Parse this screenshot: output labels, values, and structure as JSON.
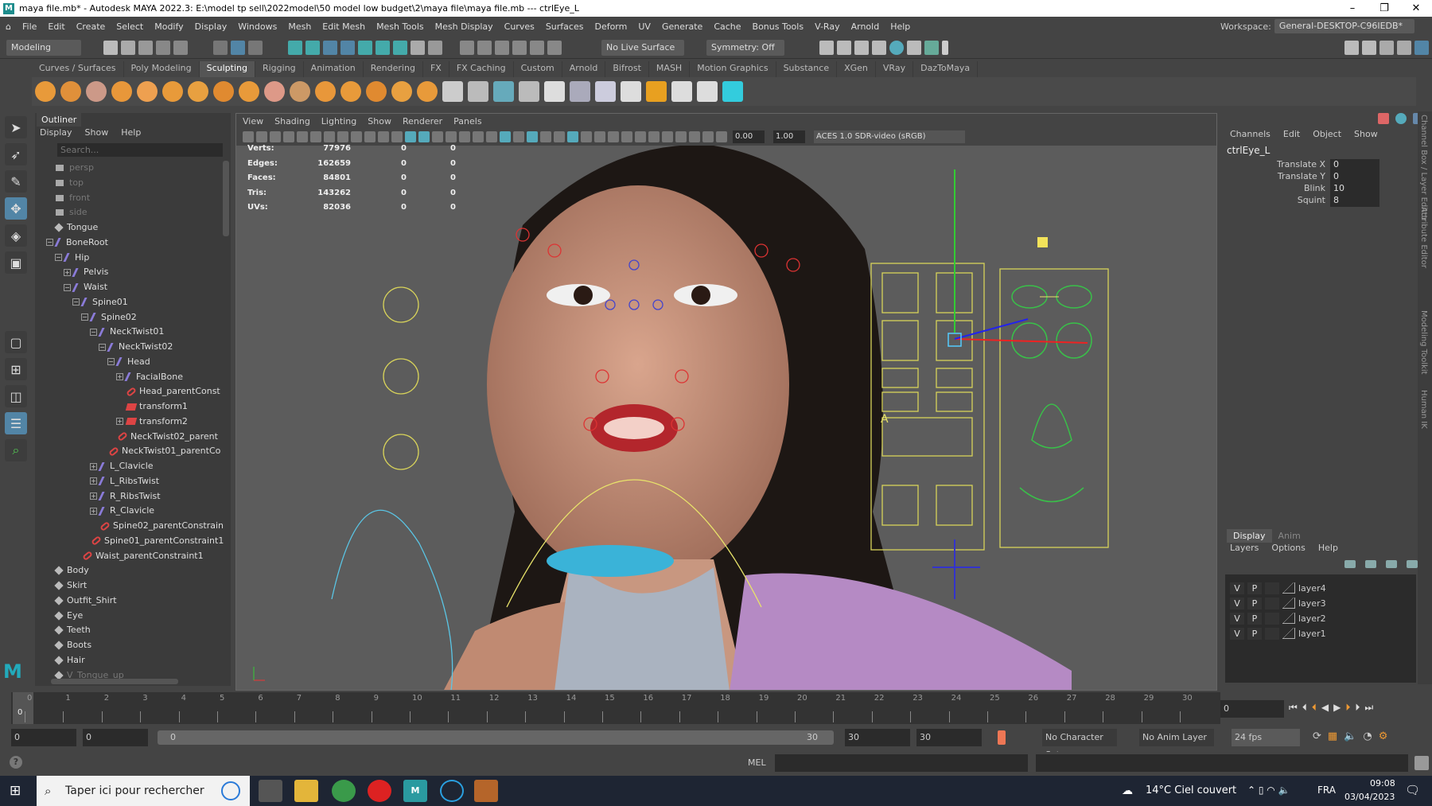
{
  "window": {
    "title": "maya file.mb* - Autodesk MAYA 2022.3: E:\\model tp sell\\2022model\\50 model low budget\\2\\maya file\\maya file.mb  ---  ctrlEye_L",
    "minimize": "–",
    "restore": "❐",
    "close": "✕"
  },
  "menubar": [
    "File",
    "Edit",
    "Create",
    "Select",
    "Modify",
    "Display",
    "Windows",
    "Mesh",
    "Edit Mesh",
    "Mesh Tools",
    "Mesh Display",
    "Curves",
    "Surfaces",
    "Deform",
    "UV",
    "Generate",
    "Cache",
    "Bonus Tools",
    "V-Ray",
    "Arnold",
    "Help"
  ],
  "workspace": {
    "label": "Workspace:",
    "value": "General-DESKTOP-C96IEDB*"
  },
  "statusline": {
    "menuset": "Modeling",
    "live_surface": "No Live Surface",
    "symmetry": "Symmetry: Off"
  },
  "shelf_tabs": [
    "Curves / Surfaces",
    "Poly Modeling",
    "Sculpting",
    "Rigging",
    "Animation",
    "Rendering",
    "FX",
    "FX Caching",
    "Custom",
    "Arnold",
    "Bifrost",
    "MASH",
    "Motion Graphics",
    "Substance",
    "XGen",
    "VRay",
    "DazToMaya"
  ],
  "shelf_active": "Sculpting",
  "outliner": {
    "tab": "Outliner",
    "menu": [
      "Display",
      "Show",
      "Help"
    ],
    "search_placeholder": "Search...",
    "items": [
      {
        "name": "persp",
        "type": "cam",
        "depth": 0,
        "dim": true
      },
      {
        "name": "top",
        "type": "cam",
        "depth": 0,
        "dim": true
      },
      {
        "name": "front",
        "type": "cam",
        "depth": 0,
        "dim": true
      },
      {
        "name": "side",
        "type": "cam",
        "depth": 0,
        "dim": true
      },
      {
        "name": "Tongue",
        "type": "mesh",
        "depth": 0
      },
      {
        "name": "BoneRoot",
        "type": "joint",
        "depth": 0,
        "exp": "−"
      },
      {
        "name": "Hip",
        "type": "joint",
        "depth": 1,
        "exp": "−"
      },
      {
        "name": "Pelvis",
        "type": "joint",
        "depth": 2,
        "exp": "+"
      },
      {
        "name": "Waist",
        "type": "joint",
        "depth": 2,
        "exp": "−"
      },
      {
        "name": "Spine01",
        "type": "joint",
        "depth": 3,
        "exp": "−"
      },
      {
        "name": "Spine02",
        "type": "joint",
        "depth": 4,
        "exp": "−"
      },
      {
        "name": "NeckTwist01",
        "type": "joint",
        "depth": 5,
        "exp": "−"
      },
      {
        "name": "NeckTwist02",
        "type": "joint",
        "depth": 6,
        "exp": "−"
      },
      {
        "name": "Head",
        "type": "joint",
        "depth": 7,
        "exp": "−"
      },
      {
        "name": "FacialBone",
        "type": "joint",
        "depth": 8,
        "exp": "+"
      },
      {
        "name": "Head_parentConst",
        "type": "con",
        "depth": 8
      },
      {
        "name": "transform1",
        "type": "xf",
        "depth": 8
      },
      {
        "name": "transform2",
        "type": "xf",
        "depth": 8,
        "exp": "+"
      },
      {
        "name": "NeckTwist02_parent",
        "type": "con",
        "depth": 7
      },
      {
        "name": "NeckTwist01_parentCo",
        "type": "con",
        "depth": 6
      },
      {
        "name": "L_Clavicle",
        "type": "joint",
        "depth": 5,
        "exp": "+"
      },
      {
        "name": "L_RibsTwist",
        "type": "joint",
        "depth": 5,
        "exp": "+"
      },
      {
        "name": "R_RibsTwist",
        "type": "joint",
        "depth": 5,
        "exp": "+"
      },
      {
        "name": "R_Clavicle",
        "type": "joint",
        "depth": 5,
        "exp": "+"
      },
      {
        "name": "Spine02_parentConstrain",
        "type": "con",
        "depth": 5
      },
      {
        "name": "Spine01_parentConstraint1",
        "type": "con",
        "depth": 4
      },
      {
        "name": "Waist_parentConstraint1",
        "type": "con",
        "depth": 3
      },
      {
        "name": "Body",
        "type": "mesh",
        "depth": 0
      },
      {
        "name": "Skirt",
        "type": "mesh",
        "depth": 0
      },
      {
        "name": "Outfit_Shirt",
        "type": "mesh",
        "depth": 0
      },
      {
        "name": "Eye",
        "type": "mesh",
        "depth": 0
      },
      {
        "name": "Teeth",
        "type": "mesh",
        "depth": 0
      },
      {
        "name": "Boots",
        "type": "mesh",
        "depth": 0
      },
      {
        "name": "Hair",
        "type": "mesh",
        "depth": 0
      },
      {
        "name": "V_Tongue_up",
        "type": "mesh",
        "depth": 0,
        "dim": true
      }
    ]
  },
  "viewport": {
    "menu": [
      "View",
      "Shading",
      "Lighting",
      "Show",
      "Renderer",
      "Panels"
    ],
    "exposure": "0.00",
    "gamma": "1.00",
    "colorspace": "ACES 1.0 SDR-video (sRGB)",
    "stats": [
      {
        "label": "Verts:",
        "v": [
          "77976",
          "0",
          "0"
        ]
      },
      {
        "label": "Edges:",
        "v": [
          "162659",
          "0",
          "0"
        ]
      },
      {
        "label": "Faces:",
        "v": [
          "84801",
          "0",
          "0"
        ]
      },
      {
        "label": "Tris:",
        "v": [
          "143262",
          "0",
          "0"
        ]
      },
      {
        "label": "UVs:",
        "v": [
          "82036",
          "0",
          "0"
        ]
      }
    ],
    "ctrl_label": "A"
  },
  "channelbox": {
    "menu": [
      "Channels",
      "Edit",
      "Object",
      "Show"
    ],
    "object": "ctrlEye_L",
    "attrs": [
      {
        "name": "Translate X",
        "value": "0"
      },
      {
        "name": "Translate Y",
        "value": "0"
      },
      {
        "name": "Blink",
        "value": "10"
      },
      {
        "name": "Squint",
        "value": "8"
      }
    ]
  },
  "layereditor": {
    "tabs": [
      "Display",
      "Anim"
    ],
    "menu": [
      "Layers",
      "Options",
      "Help"
    ],
    "layers": [
      {
        "v": "V",
        "p": "P",
        "name": "layer4"
      },
      {
        "v": "V",
        "p": "P",
        "name": "layer3"
      },
      {
        "v": "V",
        "p": "P",
        "name": "layer2"
      },
      {
        "v": "V",
        "p": "P",
        "name": "layer1"
      }
    ]
  },
  "side_tabs": [
    "Channel Box / Layer Editor",
    "Attribute Editor",
    "Modeling Toolkit",
    "Human IK"
  ],
  "timeline": {
    "start": 0,
    "end": 30,
    "current": "0",
    "current_field": "0"
  },
  "range": {
    "start": "0",
    "anim_start": "0",
    "slider_start": "0",
    "slider_end": "30",
    "anim_end": "30",
    "end": "30",
    "character_set": "No Character Set",
    "anim_layer": "No Anim Layer",
    "fps": "24 fps"
  },
  "cmdline": {
    "lang": "MEL",
    "help": "?"
  },
  "taskbar": {
    "search": "Taper ici pour rechercher",
    "weather": "14°C  Ciel couvert",
    "lang": "FRA",
    "time": "09:08",
    "date": "03/04/2023"
  }
}
